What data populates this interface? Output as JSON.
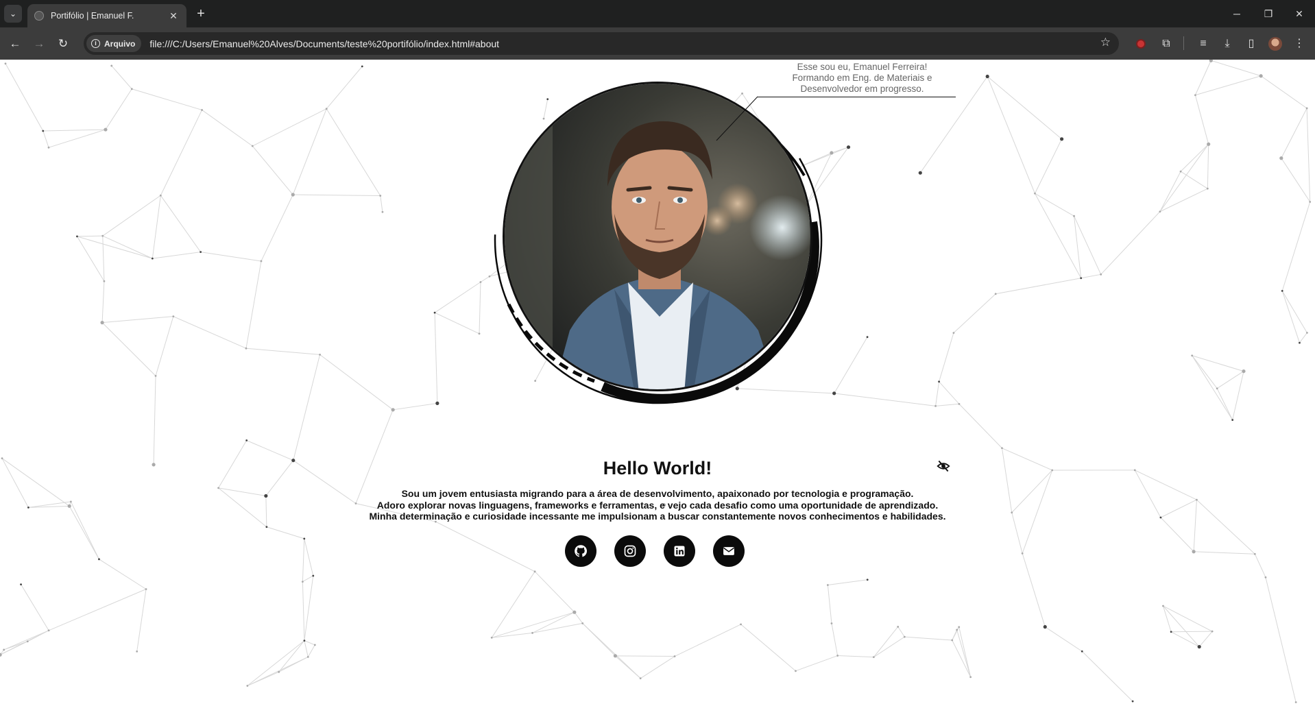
{
  "browser": {
    "tab_title": "Portifólio | Emanuel F.",
    "tab_close": "✕",
    "new_tab": "+",
    "site_chip": "Arquivo",
    "url": "file:///C:/Users/Emanuel%20Alves/Documents/teste%20portifólio/index.html#about",
    "window_controls": {
      "minimize": "─",
      "restore": "❐",
      "close": "✕"
    }
  },
  "profile": {
    "caption_lines": [
      "Esse sou eu, Emanuel Ferreira!",
      "Formando em Eng. de Materiais e",
      "Desenvolvedor em progresso."
    ],
    "photo_icon": "portrait-photo"
  },
  "about": {
    "title": "Hello World!",
    "lines": [
      "Sou um jovem entusiasta migrando para a área de desenvolvimento, apaixonado por tecnologia e programação.",
      "Adoro explorar novas linguagens, frameworks e ferramentas, e vejo cada desafio como uma oportunidade de aprendizado.",
      "Minha determinação e curiosidade incessante me impulsionam a buscar constantemente novos conhecimentos e habilidades."
    ],
    "toggle_icon": "eye-slash-icon"
  },
  "socials": [
    {
      "name": "github",
      "icon": "github-icon"
    },
    {
      "name": "instagram",
      "icon": "instagram-icon"
    },
    {
      "name": "linkedin",
      "icon": "linkedin-icon"
    },
    {
      "name": "email",
      "icon": "envelope-icon"
    }
  ],
  "colors": {
    "chrome_dark": "#1f2020",
    "chrome_toolbar": "#3c3c3c",
    "omnibox": "#282828",
    "accent_black": "#0b0b0b",
    "network_line": "#d7d7d7"
  }
}
